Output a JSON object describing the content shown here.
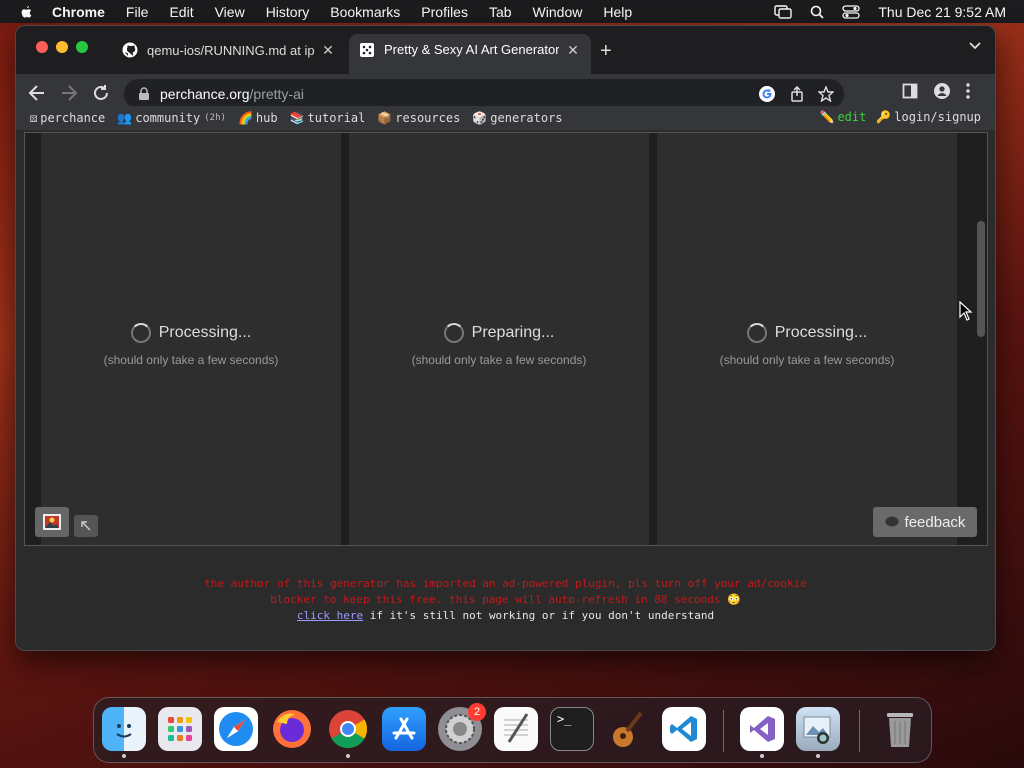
{
  "menubar": {
    "app_name": "Chrome",
    "items": [
      "File",
      "Edit",
      "View",
      "History",
      "Bookmarks",
      "Profiles",
      "Tab",
      "Window",
      "Help"
    ],
    "datetime": "Thu Dec 21  9:52 AM"
  },
  "tabs": [
    {
      "title": "qemu-ios/RUNNING.md at ipod",
      "icon": "github-icon"
    },
    {
      "title": "Pretty & Sexy AI Art Generator",
      "icon": "perchance-icon"
    }
  ],
  "omnibox": {
    "host": "perchance.org",
    "path": "/pretty-ai"
  },
  "bookmarks": {
    "left": [
      {
        "icon": "⚄",
        "label": "perchance",
        "extra": ""
      },
      {
        "icon": "👥",
        "label": "community",
        "extra": "(2h)"
      },
      {
        "icon": "🌈",
        "label": "hub",
        "extra": ""
      },
      {
        "icon": "📚",
        "label": "tutorial",
        "extra": ""
      },
      {
        "icon": "📦",
        "label": "resources",
        "extra": ""
      },
      {
        "icon": "🎲",
        "label": "generators",
        "extra": ""
      }
    ],
    "edit": "edit",
    "login": "login/signup"
  },
  "panels": [
    {
      "status": "Processing...",
      "sub": "(should only take a few seconds)"
    },
    {
      "status": "Preparing...",
      "sub": "(should only take a few seconds)"
    },
    {
      "status": "Processing...",
      "sub": "(should only take a few seconds)"
    }
  ],
  "feedback_label": "feedback",
  "notice": {
    "line1": "the author of this generator has imported an ad-powered plugin, pls turn off your ad/cookie",
    "line2": "blocker to keep this free. this page will auto-refresh in 88 seconds 😳",
    "link": "click here",
    "line3_rest": " if it's still not working or if you don't understand"
  },
  "dock": {
    "apps": [
      "finder",
      "launchpad",
      "safari",
      "firefox",
      "chrome",
      "app-store",
      "system-settings",
      "textedit",
      "terminal",
      "garageband",
      "vscode",
      "visual-studio",
      "preview",
      "trash"
    ],
    "settings_badge": "2"
  },
  "colors": {
    "notice_red": "#c0191b",
    "link": "#9b9bff"
  }
}
